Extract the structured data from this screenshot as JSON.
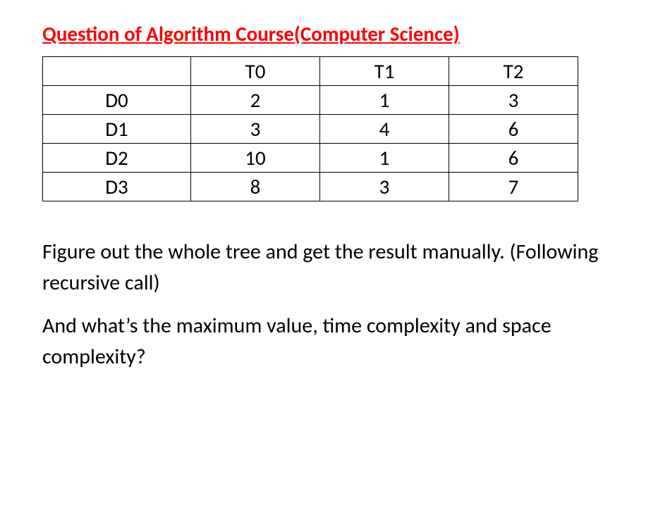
{
  "title": "Question of Algorithm Course(Computer Science)",
  "table": {
    "headers": [
      "",
      "T0",
      "T1",
      "T2"
    ],
    "rows": [
      {
        "label": "D0",
        "values": [
          "2",
          "1",
          "3"
        ]
      },
      {
        "label": "D1",
        "values": [
          "3",
          "4",
          "6"
        ]
      },
      {
        "label": "D2",
        "values": [
          "10",
          "1",
          "6"
        ]
      },
      {
        "label": "D3",
        "values": [
          "8",
          "3",
          "7"
        ]
      }
    ]
  },
  "paragraph1": "Figure out the whole tree and get the result manually. (Following recursive call)",
  "paragraph2": "And what’s the maximum value, time complexity and space complexity?"
}
